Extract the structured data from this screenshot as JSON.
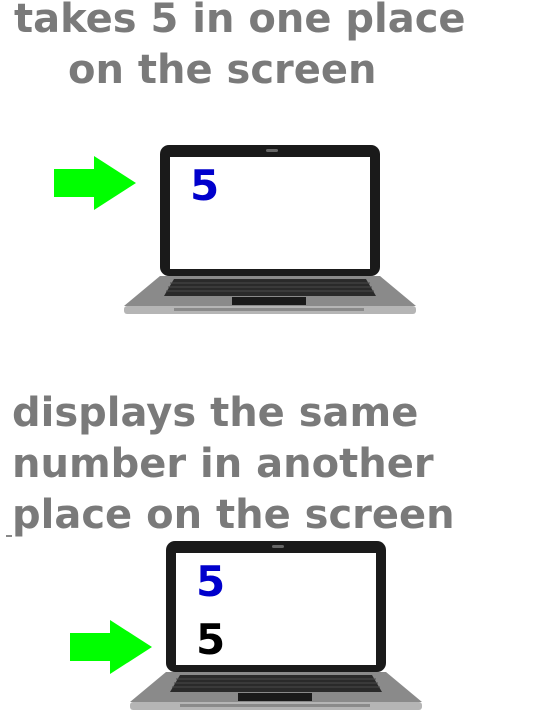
{
  "top_caption": {
    "line1": "takes 5 in one place",
    "line2": "on the screen"
  },
  "bottom_caption": {
    "line1": "displays the same",
    "line2": "number in another",
    "line3": "place on the screen"
  },
  "panel1": {
    "digit": "5",
    "digit_color": "#0000cc",
    "arrow_color": "#00ff00",
    "icons": [
      "arrow-right-icon",
      "laptop-icon"
    ]
  },
  "panel2": {
    "digit_top": "5",
    "digit_top_color": "#0000cc",
    "digit_bottom": "5",
    "digit_bottom_color": "#000000",
    "arrow_color": "#00ff00",
    "icons": [
      "arrow-right-icon",
      "laptop-icon"
    ]
  },
  "colors": {
    "caption": "#7a7a7a",
    "laptop_body": "#1a1a1a",
    "laptop_base": "#8a8a8a"
  }
}
